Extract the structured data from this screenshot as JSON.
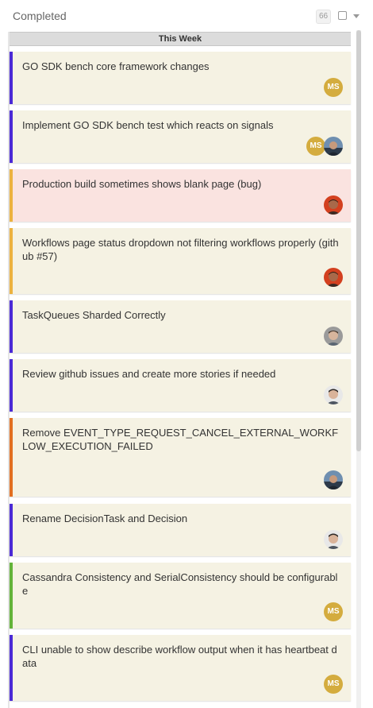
{
  "column": {
    "title": "Completed",
    "count": "66"
  },
  "swimlane": {
    "label": "This Week"
  },
  "colors": {
    "purple": "#4b2ad6",
    "orange": "#ecb23f",
    "dark_orange": "#e26f21",
    "green": "#63b33a",
    "card_bg": "#f5f2e3",
    "card_bug_bg": "#fae3e0",
    "avatar_ms": "#d4ac3e"
  },
  "cards": [
    {
      "title": "GO SDK bench core framework changes",
      "type": "feature",
      "avatars": [
        {
          "kind": "initials",
          "text": "MS"
        }
      ]
    },
    {
      "title": "Implement GO SDK bench test which reacts on signals",
      "type": "feature",
      "avatars": [
        {
          "kind": "initials",
          "text": "MS"
        },
        {
          "kind": "photo",
          "icon": "user-photo-outdoor"
        }
      ]
    },
    {
      "title": "Production build sometimes shows blank page (bug)",
      "type": "bug",
      "avatars": [
        {
          "kind": "photo",
          "icon": "user-photo-red"
        }
      ]
    },
    {
      "title": "Workflows page status dropdown not filtering workflows properly (github #57)",
      "type": "bug-minor",
      "avatars": [
        {
          "kind": "photo",
          "icon": "user-photo-red"
        }
      ]
    },
    {
      "title": "TaskQueues Sharded Correctly",
      "type": "feature",
      "avatars": [
        {
          "kind": "photo",
          "icon": "user-photo-gray"
        }
      ]
    },
    {
      "title": "Review github issues and create more stories if needed",
      "type": "feature",
      "avatars": [
        {
          "kind": "photo",
          "icon": "user-photo-light"
        }
      ]
    },
    {
      "title": "Remove EVENT_TYPE_REQUEST_CANCEL_EXTERNAL_WORKFLOW_EXECUTION_FAILED",
      "type": "chore",
      "avatars": [
        {
          "kind": "photo",
          "icon": "user-photo-outdoor"
        }
      ]
    },
    {
      "title": "Rename DecisionTask and Decision",
      "type": "feature",
      "avatars": [
        {
          "kind": "photo",
          "icon": "user-photo-light"
        }
      ]
    },
    {
      "title": "Cassandra Consistency and SerialConsistency should be configurable",
      "type": "improvement",
      "avatars": [
        {
          "kind": "initials",
          "text": "MS"
        }
      ]
    },
    {
      "title": "CLI unable to show describe workflow output when it has heartbeat data",
      "type": "feature",
      "avatars": [
        {
          "kind": "initials",
          "text": "MS"
        }
      ]
    }
  ]
}
